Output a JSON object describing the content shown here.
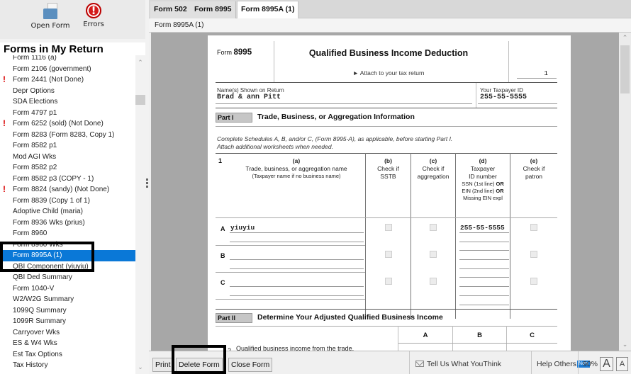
{
  "toolbar": {
    "open_form_label": "Open Form",
    "errors_label": "Errors"
  },
  "panel": {
    "title": "Forms in My Return",
    "items": [
      {
        "label": "Form 1116 (a)",
        "warning": false,
        "selected": false
      },
      {
        "label": "Form 2106 (government)",
        "warning": false,
        "selected": false
      },
      {
        "label": "Form 2441 (Not Done)",
        "warning": true,
        "selected": false
      },
      {
        "label": "Depr Options",
        "warning": false,
        "selected": false
      },
      {
        "label": "SDA Elections",
        "warning": false,
        "selected": false
      },
      {
        "label": "Form 4797 p1",
        "warning": false,
        "selected": false
      },
      {
        "label": "Form 6252 (sold) (Not Done)",
        "warning": true,
        "selected": false
      },
      {
        "label": "Form 8283 (Form 8283, Copy 1)",
        "warning": false,
        "selected": false
      },
      {
        "label": "Form 8582 p1",
        "warning": false,
        "selected": false
      },
      {
        "label": "Mod AGI Wks",
        "warning": false,
        "selected": false
      },
      {
        "label": "Form 8582 p2",
        "warning": false,
        "selected": false
      },
      {
        "label": "Form 8582 p3 (COPY -    1)",
        "warning": false,
        "selected": false
      },
      {
        "label": "Form 8824 (sandy) (Not Done)",
        "warning": true,
        "selected": false
      },
      {
        "label": "Form 8839 (Copy 1 of 1)",
        "warning": false,
        "selected": false
      },
      {
        "label": "Adoptive Child (maria)",
        "warning": false,
        "selected": false
      },
      {
        "label": "Form 8936 Wks (prius)",
        "warning": false,
        "selected": false
      },
      {
        "label": "Form 8960",
        "warning": false,
        "selected": false
      },
      {
        "label": "Form 8960 Wks",
        "warning": false,
        "selected": false
      },
      {
        "label": "Form 8995A (1)",
        "warning": false,
        "selected": true
      },
      {
        "label": "QBI Component (yiuyiu)",
        "warning": false,
        "selected": false
      },
      {
        "label": "QBI Ded Summary",
        "warning": false,
        "selected": false
      },
      {
        "label": "Form 1040-V",
        "warning": false,
        "selected": false
      },
      {
        "label": "W2/W2G Summary",
        "warning": false,
        "selected": false
      },
      {
        "label": "1099Q Summary",
        "warning": false,
        "selected": false
      },
      {
        "label": "1099R Summary",
        "warning": false,
        "selected": false
      },
      {
        "label": "Carryover Wks",
        "warning": false,
        "selected": false
      },
      {
        "label": "ES & W4 Wks",
        "warning": false,
        "selected": false
      },
      {
        "label": "Est Tax Options",
        "warning": false,
        "selected": false
      },
      {
        "label": "Tax History",
        "warning": false,
        "selected": false
      }
    ]
  },
  "tabs": [
    {
      "label": "Form 502",
      "active": false
    },
    {
      "label": "Form 8995",
      "active": false
    },
    {
      "label": "Form 8995A (1)",
      "active": true
    }
  ],
  "subbar": {
    "label": "Form 8995A (1)"
  },
  "form": {
    "form_prefix": "Form",
    "form_number": "8995",
    "title": "Qualified Business Income Deduction",
    "attach": "► Attach to your tax return",
    "sequence": "1",
    "name_label": "Name(s) Shown on Return",
    "name_value": "Brad & ann Pitt",
    "id_label": "Your Taxpayer ID",
    "id_value": "255-55-5555",
    "part1": {
      "tag": "Part I",
      "title": "Trade, Business, or Aggregation Information",
      "instr1": "Complete Schedules A, B, and/or C, (Form 8995-A), as applicable, before starting Part I.",
      "instr2": "Attach additional worksheets when needed.",
      "line_num": "1",
      "col_a": {
        "letter": "(a)",
        "l1": "Trade, business, or aggregation name",
        "l2": "(Taxpayer name if no business name)"
      },
      "col_b": {
        "letter": "(b)",
        "l1": "Check if",
        "l2": "SSTB"
      },
      "col_c": {
        "letter": "(c)",
        "l1": "Check if",
        "l2": "aggregation"
      },
      "col_d": {
        "letter": "(d)",
        "l1": "Taxpayer",
        "l2": "ID number",
        "l3a": "SSN (1st line) ",
        "l3b": "OR",
        "l4a": "EIN (2nd line) ",
        "l4b": "OR",
        "l5": "Missing EIN expl"
      },
      "col_e": {
        "letter": "(e)",
        "l1": "Check if",
        "l2": "patron"
      },
      "rows": [
        {
          "letter": "A",
          "name": "yiuyiu",
          "sstb": false,
          "aggregation": false,
          "tin": "255-55-5555",
          "patron": false
        },
        {
          "letter": "B",
          "name": "",
          "sstb": false,
          "aggregation": false,
          "tin": "",
          "patron": false
        },
        {
          "letter": "C",
          "name": "",
          "sstb": false,
          "aggregation": false,
          "tin": "",
          "patron": false
        }
      ]
    },
    "part2": {
      "tag": "Part II",
      "title": "Determine Your Adjusted Qualified Business Income",
      "cols": [
        "A",
        "B",
        "C"
      ],
      "line2_num": "2",
      "line2_text": "Qualified business income from the trade,"
    }
  },
  "bottombar": {
    "print": "Print",
    "delete": "Delete Form",
    "close": "Close Form",
    "feedback": "Tell Us What YouThink",
    "help": "Help Others",
    "new_badge": "New",
    "zoom": "90%",
    "font_large": "A",
    "font_small": "A"
  }
}
